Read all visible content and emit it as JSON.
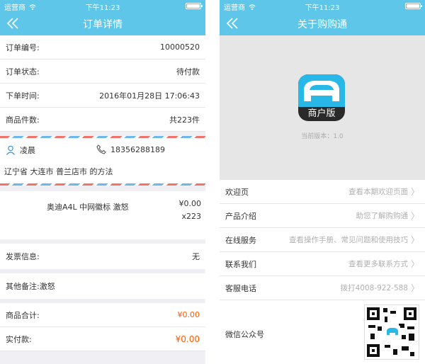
{
  "left": {
    "status": {
      "carrier": "运营商",
      "time": "下午11:23"
    },
    "nav": {
      "title": "订单详情"
    },
    "order_rows": [
      {
        "label": "订单编号:",
        "value": "10000520"
      },
      {
        "label": "订单状态:",
        "value": "待付款"
      },
      {
        "label": "下单时间:",
        "value": "2016年01月28日 17:06:43"
      },
      {
        "label": "商品件数:",
        "value": "共223件"
      }
    ],
    "address": {
      "name": "凌晨",
      "phone": "18356288189",
      "address": "辽宁省 大连市 普兰店市 的方法"
    },
    "product": {
      "name": "奥迪A4L 中网徽标 激怒",
      "price": "¥0.00",
      "qty": "x223"
    },
    "invoice": {
      "label": "发票信息:",
      "value": "无"
    },
    "remark": {
      "label": "其他备注:",
      "value": "激怒"
    },
    "totals": {
      "goods_label": "商品合计:",
      "goods_value": "¥0.00",
      "paid_label": "实付款:",
      "paid_value": "¥0.00"
    },
    "colors": {
      "accent": "#5ec7e9",
      "price": "#ff5a00"
    }
  },
  "right": {
    "status": {
      "carrier": "运营商",
      "time": "下午11:23"
    },
    "nav": {
      "title": "关于购购通"
    },
    "logo_text": "商户版",
    "version": "当前版本：1.0",
    "menu": [
      {
        "label": "欢迎页",
        "hint": "查看本期欢迎页面"
      },
      {
        "label": "产品介绍",
        "hint": "助您了解购购通"
      },
      {
        "label": "在线服务",
        "hint": "查看操作手册、常见问题和使用技巧"
      },
      {
        "label": "联系我们",
        "hint": "查看更多联系方式"
      },
      {
        "label": "客服电话",
        "hint": "拨打4008-922-588"
      }
    ],
    "wechat_label": "微信公众号",
    "icons": {
      "back": "double-chevron-left-icon",
      "chevron": "chevron-right-icon",
      "person": "person-icon",
      "phone": "phone-icon",
      "wifi": "wifi-icon",
      "battery": "battery-icon",
      "qr": "qr-code"
    }
  }
}
